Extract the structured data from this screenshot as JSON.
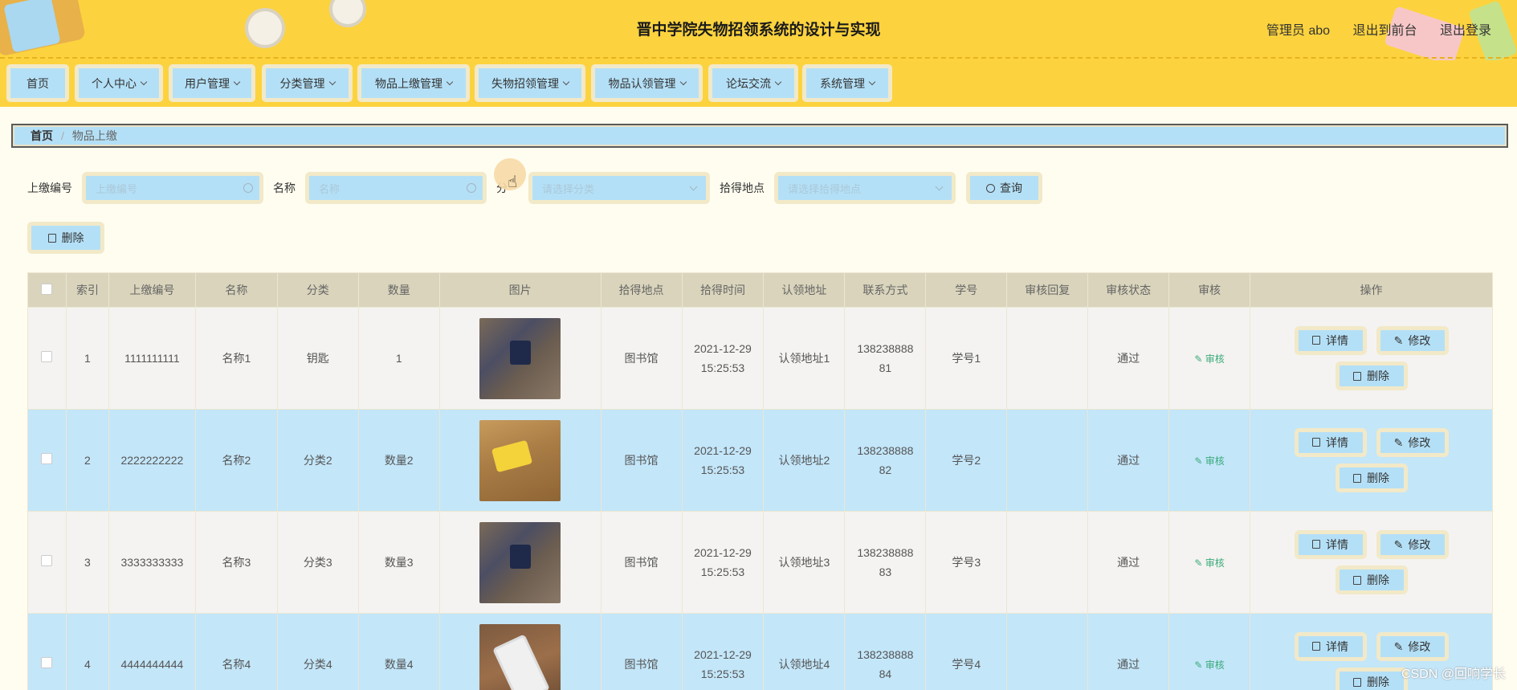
{
  "header": {
    "title": "晋中学院失物招领系统的设计与实现",
    "admin_label": "管理员 abo",
    "to_front": "退出到前台",
    "logout": "退出登录"
  },
  "nav": {
    "home": "首页",
    "personal": "个人中心",
    "users": "用户管理",
    "category": "分类管理",
    "submit": "物品上缴管理",
    "lost": "失物招领管理",
    "claim": "物品认领管理",
    "forum": "论坛交流",
    "system": "系统管理"
  },
  "breadcrumb": {
    "home": "首页",
    "current": "物品上缴"
  },
  "search": {
    "code_label": "上缴编号",
    "code_placeholder": "上缴编号",
    "name_label": "名称",
    "name_placeholder": "名称",
    "cat_label": "分",
    "cat_placeholder": "请选择分类",
    "place_label": "拾得地点",
    "place_placeholder": "请选择拾得地点",
    "query_btn": "查询",
    "delete_btn": "删除"
  },
  "table": {
    "headers": [
      "索引",
      "上缴编号",
      "名称",
      "分类",
      "数量",
      "图片",
      "拾得地点",
      "拾得时间",
      "认领地址",
      "联系方式",
      "学号",
      "审核回复",
      "审核状态",
      "审核",
      "操作"
    ],
    "rows": [
      {
        "index": "1",
        "code": "1111111111",
        "name": "名称1",
        "category": "钥匙",
        "qty": "1",
        "image": "keys",
        "place": "图书馆",
        "date": "2021-12-29",
        "time": "15:25:53",
        "addr": "认领地址1",
        "phone1": "138238888",
        "phone2": "81",
        "sid": "学号1",
        "reply": "",
        "status": "通过",
        "audit": "审核",
        "detail": "详情",
        "edit": "修改",
        "delete": "删除"
      },
      {
        "index": "2",
        "code": "2222222222",
        "name": "名称2",
        "category": "分类2",
        "qty": "数量2",
        "image": "yellow-keychain",
        "place": "图书馆",
        "date": "2021-12-29",
        "time": "15:25:53",
        "addr": "认领地址2",
        "phone1": "138238888",
        "phone2": "82",
        "sid": "学号2",
        "reply": "",
        "status": "通过",
        "audit": "审核",
        "detail": "详情",
        "edit": "修改",
        "delete": "删除"
      },
      {
        "index": "3",
        "code": "3333333333",
        "name": "名称3",
        "category": "分类3",
        "qty": "数量3",
        "image": "keys",
        "place": "图书馆",
        "date": "2021-12-29",
        "time": "15:25:53",
        "addr": "认领地址3",
        "phone1": "138238888",
        "phone2": "83",
        "sid": "学号3",
        "reply": "",
        "status": "通过",
        "audit": "审核",
        "detail": "详情",
        "edit": "修改",
        "delete": "删除"
      },
      {
        "index": "4",
        "code": "4444444444",
        "name": "名称4",
        "category": "分类4",
        "qty": "数量4",
        "image": "phone",
        "place": "图书馆",
        "date": "2021-12-29",
        "time": "15:25:53",
        "addr": "认领地址4",
        "phone1": "138238888",
        "phone2": "84",
        "sid": "学号4",
        "reply": "",
        "status": "通过",
        "audit": "审核",
        "detail": "详情",
        "edit": "修改",
        "delete": "删除"
      }
    ]
  },
  "watermark": "CSDN @回响学长"
}
